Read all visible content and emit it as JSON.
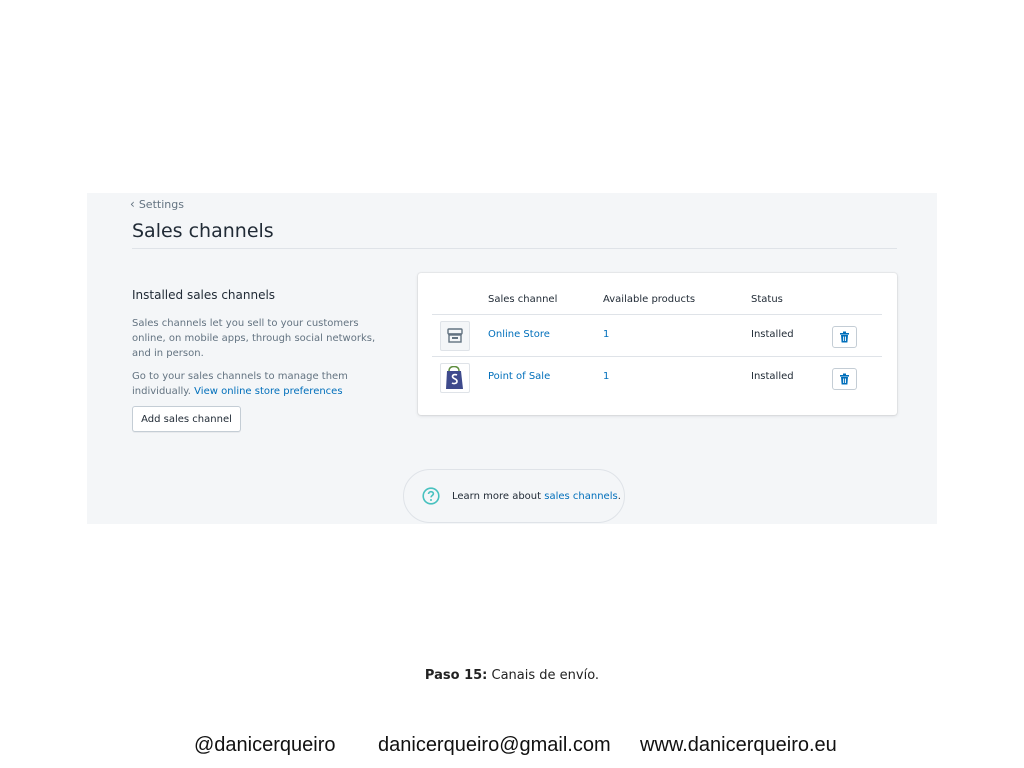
{
  "breadcrumb": {
    "back_label": "Settings"
  },
  "page": {
    "title": "Sales channels"
  },
  "installed": {
    "title": "Installed sales channels",
    "description": "Sales channels let you sell to your customers online, on mobile apps, through social networks, and in person.",
    "manage_text": "Go to your sales channels to manage them individually.",
    "preferences_link": "View online store preferences",
    "add_button": "Add sales channel"
  },
  "table": {
    "headers": [
      "Sales channel",
      "Available products",
      "Status"
    ],
    "rows": [
      {
        "icon": "online-store-icon",
        "name": "Online Store",
        "products": "1",
        "status": "Installed"
      },
      {
        "icon": "point-of-sale-icon",
        "name": "Point of Sale",
        "products": "1",
        "status": "Installed"
      }
    ]
  },
  "help": {
    "prefix": "Learn more about",
    "link": "sales channels",
    "suffix": "."
  },
  "caption": {
    "step": "Paso 15:",
    "text": "Canais de envío."
  },
  "footer": {
    "handle": "@danicerqueiro",
    "email": "danicerqueiro@gmail.com",
    "website": "www.danicerqueiro.eu"
  },
  "colors": {
    "link": "#006fbb",
    "background": "#f4f6f8",
    "icon_teal": "#47c1bf"
  }
}
